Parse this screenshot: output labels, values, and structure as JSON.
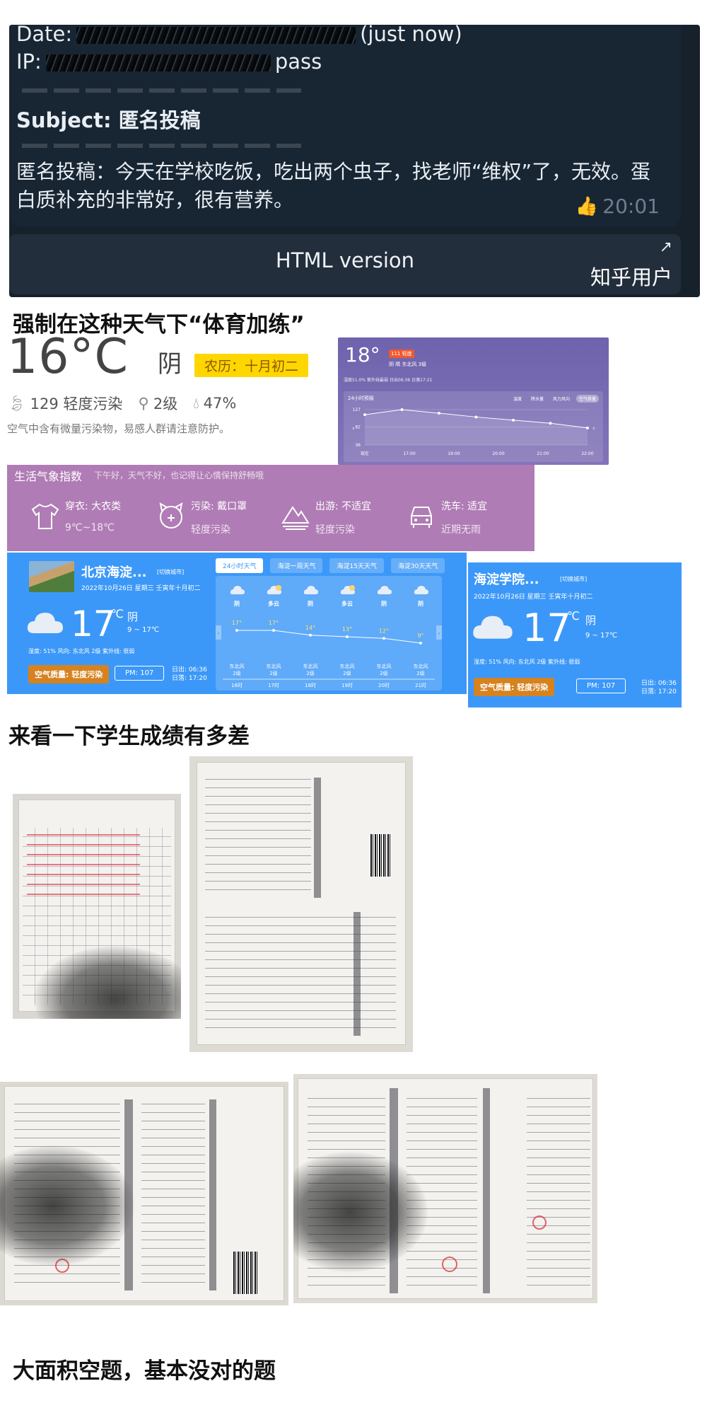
{
  "telegram": {
    "date_label": "Date:",
    "date_suffix": "(just now)",
    "ip_label": "IP:",
    "ip_suffix": "pass",
    "subject_label": "Subject:",
    "subject_value": "匿名投稿",
    "message": "匿名投稿：今天在学校吃饭，吃出两个虫子，找老师“维权”了，无效。蛋白质补充的非常好，很有营养。",
    "time": "20:01",
    "html_button": "HTML version",
    "watermark": "知乎用户"
  },
  "headings": {
    "weather": "强制在这种天气下“体育加练”",
    "grades": "来看一下学生成绩有多差",
    "blank": "大面积空题，基本没对的题"
  },
  "weather_main": {
    "temp": "16°C",
    "condition": "阴",
    "lunar": "农历：十月初二",
    "aqi": "129 轻度污染",
    "wind": "2级",
    "humidity": "47%",
    "note": "空气中含有微量污染物，易感人群请注意防护。"
  },
  "purple_widget": {
    "temp": "18°",
    "tag": "111 轻度",
    "sub": "阴 晴    东北风    3级",
    "mini": "湿度51.0%    紫外线最弱    日出06:36    日落17:21",
    "caption": "24小时预报",
    "tabs": [
      "温度",
      "降水量",
      "风力风向",
      "空气质量"
    ]
  },
  "life_index": {
    "title": "生活气象指数",
    "note": "下午好，天气不好，也记得让心情保持舒畅哦",
    "items": [
      {
        "title": "穿衣: 大衣类",
        "detail": "9℃~18℃",
        "icon": "shirt-icon"
      },
      {
        "title": "污染: 戴口罩",
        "detail": "轻度污染",
        "icon": "mask-icon"
      },
      {
        "title": "出游: 不适宜",
        "detail": "轻度污染",
        "icon": "travel-icon"
      },
      {
        "title": "洗车: 适宜",
        "detail": "近期无雨",
        "icon": "car-icon"
      }
    ]
  },
  "blue_widget_1": {
    "city": "北京海淀...",
    "switch": "[切换城市]",
    "date": "2022年10月26日    星期三    壬寅年十月初二",
    "temp": "17",
    "unit": "℃",
    "condition": "阴",
    "range": "9 ~ 17℃",
    "extra": "湿度: 51%    风向: 东北风 2级    紫外线: 很弱",
    "air_quality": "空气质量: 轻度污染",
    "pm": "PM: 107",
    "sunrise": "日出: 06:36",
    "sunset": "日落: 17:20",
    "tabs": [
      "24小时天气",
      "海淀一周天气",
      "海淀15天天气",
      "海淀30天天气"
    ],
    "forecast": [
      {
        "cond": "阴",
        "temp": 17,
        "temp_label": "17°",
        "wind": "东北风",
        "level": "2级",
        "time": "16时"
      },
      {
        "cond": "多云",
        "temp": 17,
        "temp_label": "17°",
        "wind": "东北风",
        "level": "2级",
        "time": "17时"
      },
      {
        "cond": "阴",
        "temp": 14,
        "temp_label": "14°",
        "wind": "东北风",
        "level": "2级",
        "time": "18时"
      },
      {
        "cond": "多云",
        "temp": 13,
        "temp_label": "13°",
        "wind": "东北风",
        "level": "2级",
        "time": "19时"
      },
      {
        "cond": "阴",
        "temp": 12,
        "temp_label": "12°",
        "wind": "东北风",
        "level": "2级",
        "time": "20时"
      },
      {
        "cond": "阴",
        "temp": 9,
        "temp_label": "9°",
        "wind": "东北风",
        "level": "2级",
        "time": "21时"
      }
    ]
  },
  "blue_widget_2": {
    "city": "海淀学院...",
    "switch": "[切换城市]",
    "date": "2022年10月26日    星期三    壬寅年十月初二",
    "temp": "17",
    "unit": "℃",
    "condition": "阴",
    "range": "9 ~ 17℃",
    "extra": "湿度: 51%    风向: 东北风 2级    紫外线: 很弱",
    "air_quality": "空气质量: 轻度污染",
    "pm": "PM: 107",
    "sunrise": "日出: 06:36",
    "sunset": "日落: 17:20"
  },
  "chart_data": {
    "type": "line",
    "x": [
      "现在",
      "17:00",
      "19:00",
      "20:00",
      "21:00",
      "22:00"
    ],
    "values": [
      114,
      127,
      118,
      108,
      100,
      92,
      80
    ],
    "y_ticks": [
      127,
      82,
      36
    ],
    "ylim": [
      36,
      127
    ]
  },
  "colors": {
    "telegram_bg": "#17212b",
    "purple": "#7466b0",
    "life_bg": "#b07cb5",
    "blue": "#3c98f8",
    "air_badge": "#d6821f",
    "lunar_badge": "#ffd600"
  }
}
